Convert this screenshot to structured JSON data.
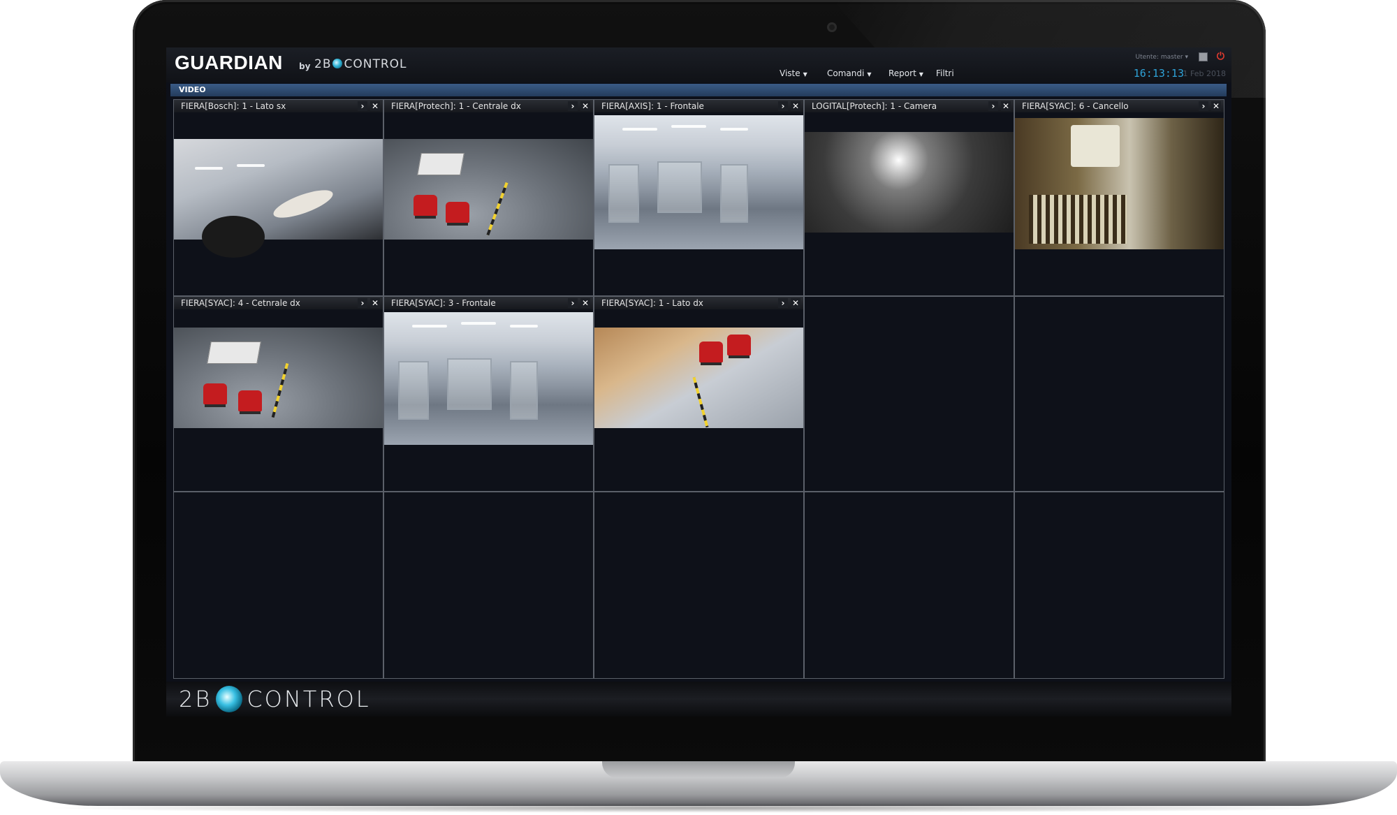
{
  "app": {
    "brand": "GUARDIAN",
    "by": "by",
    "company_prefix": "2B",
    "company_suffix": "CONTROL"
  },
  "header": {
    "user_label": "Utente: master",
    "menu": [
      {
        "label": "Viste"
      },
      {
        "label": "Comandi"
      },
      {
        "label": "Report"
      },
      {
        "label": "Filtri"
      }
    ],
    "clock": "16:13:13",
    "date": "1 Feb 2018"
  },
  "section": {
    "title": "VIDEO"
  },
  "cameras": [
    {
      "title": "FIERA[Bosch]: 1 - Lato sx",
      "scene": "scene-tilt"
    },
    {
      "title": "FIERA[Protech]: 1 - Centrale dx",
      "scene": "scene-office"
    },
    {
      "title": "FIERA[AXIS]: 1 - Frontale",
      "scene": "scene-warehouse"
    },
    {
      "title": "LOGITAL[Protech]: 1 - Camera",
      "scene": "scene-dark"
    },
    {
      "title": "FIERA[SYAC]: 6 - Cancello",
      "scene": "scene-gate"
    },
    {
      "title": "FIERA[SYAC]: 4 - Cetnrale dx",
      "scene": "scene-office"
    },
    {
      "title": "FIERA[SYAC]: 3 - Frontale",
      "scene": "scene-warehouse"
    },
    {
      "title": "FIERA[SYAC]: 1 - Lato dx",
      "scene": "scene-boxes"
    }
  ],
  "footer": {
    "logo_prefix": "2B",
    "logo_suffix": "CONTROL"
  },
  "colors": {
    "accent": "#2ea3d8",
    "power": "#e03a2f",
    "section_bar": "#3a5b86"
  },
  "icons": {
    "expand": "chevron-right-icon",
    "close": "close-icon",
    "power": "power-icon",
    "window": "window-icon"
  }
}
